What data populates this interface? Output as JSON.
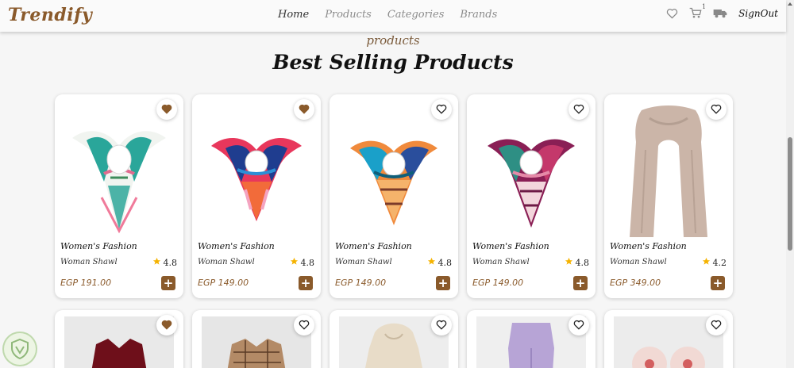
{
  "navbar": {
    "brand": "Trendify",
    "links": [
      "Home",
      "Products",
      "Categories",
      "Brands"
    ],
    "cart_count": "1",
    "signout": "SignOut"
  },
  "section": {
    "subtitle": "products",
    "title": "Best Selling Products"
  },
  "products": [
    {
      "category": "Women's Fashion",
      "name": "Woman Shawl",
      "rating": "4.8",
      "price": "EGP 191.00",
      "wishlisted": true
    },
    {
      "category": "Women's Fashion",
      "name": "Woman Shawl",
      "rating": "4.8",
      "price": "EGP 149.00",
      "wishlisted": true
    },
    {
      "category": "Women's Fashion",
      "name": "Woman Shawl",
      "rating": "4.8",
      "price": "EGP 149.00",
      "wishlisted": false
    },
    {
      "category": "Women's Fashion",
      "name": "Woman Shawl",
      "rating": "4.8",
      "price": "EGP 149.00",
      "wishlisted": false
    },
    {
      "category": "Women's Fashion",
      "name": "Woman Shawl",
      "rating": "4.2",
      "price": "EGP 349.00",
      "wishlisted": false
    }
  ],
  "second_row_wishlisted": [
    true,
    false,
    false,
    false,
    false
  ],
  "colors": {
    "brand": "#8a5a2b",
    "accent_button": "#8a5a2b",
    "star": "#f5b301"
  },
  "icons": [
    "heart-icon",
    "cart-icon",
    "truck-icon",
    "star-icon",
    "plus-icon"
  ]
}
